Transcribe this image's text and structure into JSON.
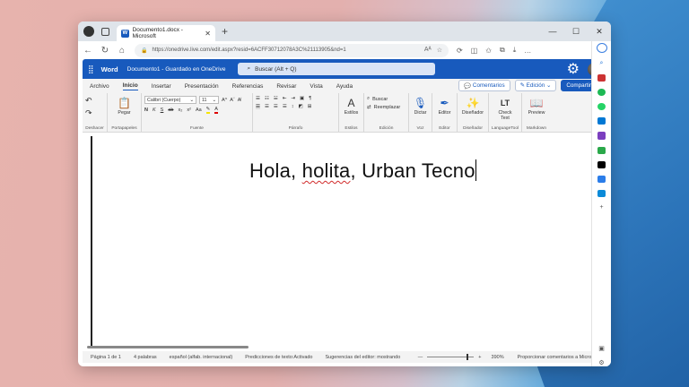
{
  "browser": {
    "tab_title": "Documento1.docx - Microsoft",
    "url": "https://onedrive.live.com/edit.aspx?resid=6ACFF30712078A3C%21113905&nd=1"
  },
  "word": {
    "app_name": "Word",
    "doc_title": "Documento1 - Guardado en OneDrive",
    "search_placeholder": "Buscar (Alt + Q)"
  },
  "ribbon_tabs": [
    "Archivo",
    "Inicio",
    "Insertar",
    "Presentación",
    "Referencias",
    "Revisar",
    "Vista",
    "Ayuda"
  ],
  "ribbon_actions": {
    "comments": "Comentarios",
    "editing": "Edición",
    "share": "Compartir"
  },
  "ribbon": {
    "paste": "Pegar",
    "font_name": "Calibri (Cuerpo)",
    "font_size": "11",
    "styles": "Estilos",
    "find": "Buscar",
    "replace": "Reemplazar",
    "dictate": "Dictar",
    "editor": "Editor",
    "designer": "Diseñador",
    "check_text": "Check Text",
    "preview": "Preview",
    "groups": {
      "undo": "Deshacer",
      "clipboard": "Portapapeles",
      "font": "Fuente",
      "paragraph": "Párrafo",
      "styles": "Estilos",
      "editing": "Edición",
      "voice": "Voz",
      "editor": "Editor",
      "designer": "Diseñador",
      "languagetool": "LanguageTool",
      "markdown": "Markdown"
    }
  },
  "document": {
    "text_before": "Hola, ",
    "misspelled": "holita",
    "text_after": ", Urban Tecno"
  },
  "status": {
    "page": "Página 1 de 1",
    "words": "4 palabras",
    "language": "español (alfab. internacional)",
    "predictions": "Predicciones de texto:Activado",
    "suggestions": "Sugerencias del editor: mostrando",
    "zoom": "390%",
    "feedback": "Proporcionar comentarios a Microsoft"
  }
}
